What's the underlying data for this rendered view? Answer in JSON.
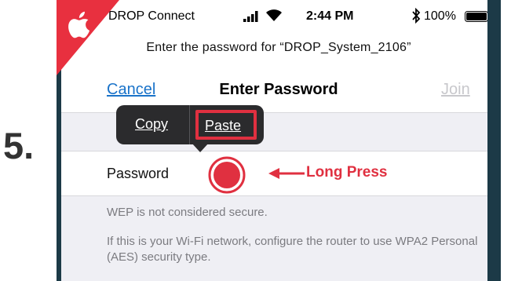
{
  "step": {
    "number": "5."
  },
  "status_bar": {
    "carrier": "DROP Connect",
    "time": "2:44 PM",
    "battery": "100%"
  },
  "prompt": {
    "text": "Enter the password for “DROP_System_2106”"
  },
  "nav": {
    "cancel_label": "Cancel",
    "title": "Enter Password",
    "join_label": "Join"
  },
  "context_menu": {
    "copy_label": "Copy",
    "paste_label": "Paste"
  },
  "password_row": {
    "label": "Password",
    "value": ""
  },
  "annotation": {
    "text": "Long Press"
  },
  "info": {
    "warning": "WEP is not considered secure.",
    "advice": "If this is your Wi-Fi network, configure the router to use WPA2 Personal (AES) security type."
  },
  "colors": {
    "accent_red": "#e03040",
    "ios_blue": "#1a73c9",
    "sidebar_dark": "#1c3a47"
  },
  "icons": {
    "brand": "apple-logo-icon",
    "signal": "cellular-signal-icon",
    "wifi": "wifi-icon",
    "bluetooth": "bluetooth-icon",
    "battery": "battery-icon",
    "arrow": "arrow-left-icon",
    "press": "press-target-icon"
  }
}
